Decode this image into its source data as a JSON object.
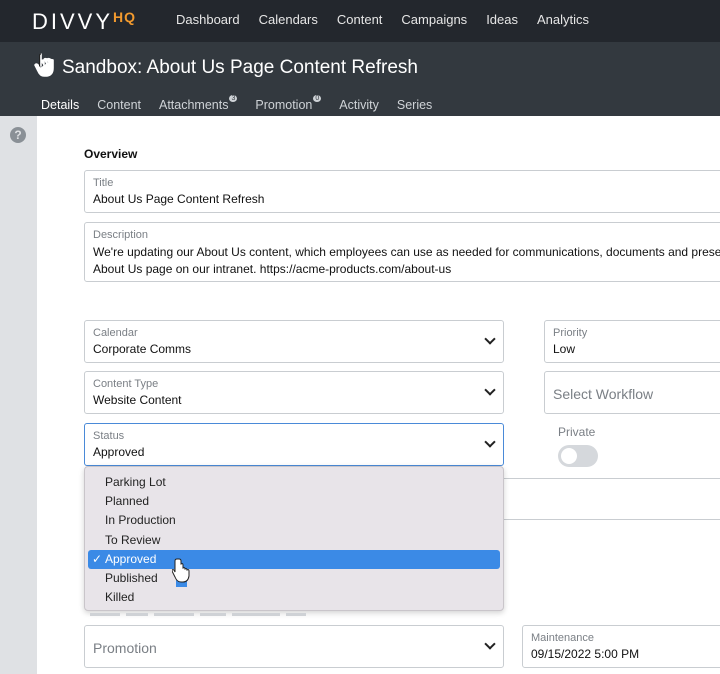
{
  "brand": {
    "logo": "DIVVY",
    "logo_suffix": "HQ",
    "accent": "#f29a2e"
  },
  "nav": {
    "items": [
      "Dashboard",
      "Calendars",
      "Content",
      "Campaigns",
      "Ideas",
      "Analytics"
    ]
  },
  "header": {
    "title": "Sandbox: About Us Page Content Refresh"
  },
  "tabs": [
    {
      "label": "Details",
      "badge": ""
    },
    {
      "label": "Content",
      "badge": ""
    },
    {
      "label": "Attachments",
      "badge": "3"
    },
    {
      "label": "Promotion",
      "badge": "0"
    },
    {
      "label": "Activity",
      "badge": ""
    },
    {
      "label": "Series",
      "badge": ""
    }
  ],
  "help": {
    "glyph": "?"
  },
  "overview": {
    "heading": "Overview",
    "title": {
      "label": "Title",
      "value": "About Us Page Content Refresh"
    },
    "description": {
      "label": "Description",
      "line1": "We're updating our About Us content, which employees can use as needed for communications, documents and prese",
      "line2": "About Us page on our intranet. https://acme-products.com/about-us"
    }
  },
  "calendar": {
    "label": "Calendar",
    "value": "Corporate Comms"
  },
  "priority": {
    "label": "Priority",
    "value": "Low"
  },
  "content_type": {
    "label": "Content Type",
    "value": "Website Content"
  },
  "workflow": {
    "placeholder": "Select Workflow"
  },
  "status": {
    "label": "Status",
    "value": "Approved",
    "options": [
      "Parking Lot",
      "Planned",
      "In Production",
      "To Review",
      "Approved",
      "Published",
      "Killed"
    ],
    "selected_index": 4,
    "check": "✓"
  },
  "private": {
    "label": "Private",
    "enabled": false
  },
  "promotion": {
    "placeholder": "Promotion"
  },
  "maintenance": {
    "label": "Maintenance",
    "value": "09/15/2022 5:00 PM"
  }
}
